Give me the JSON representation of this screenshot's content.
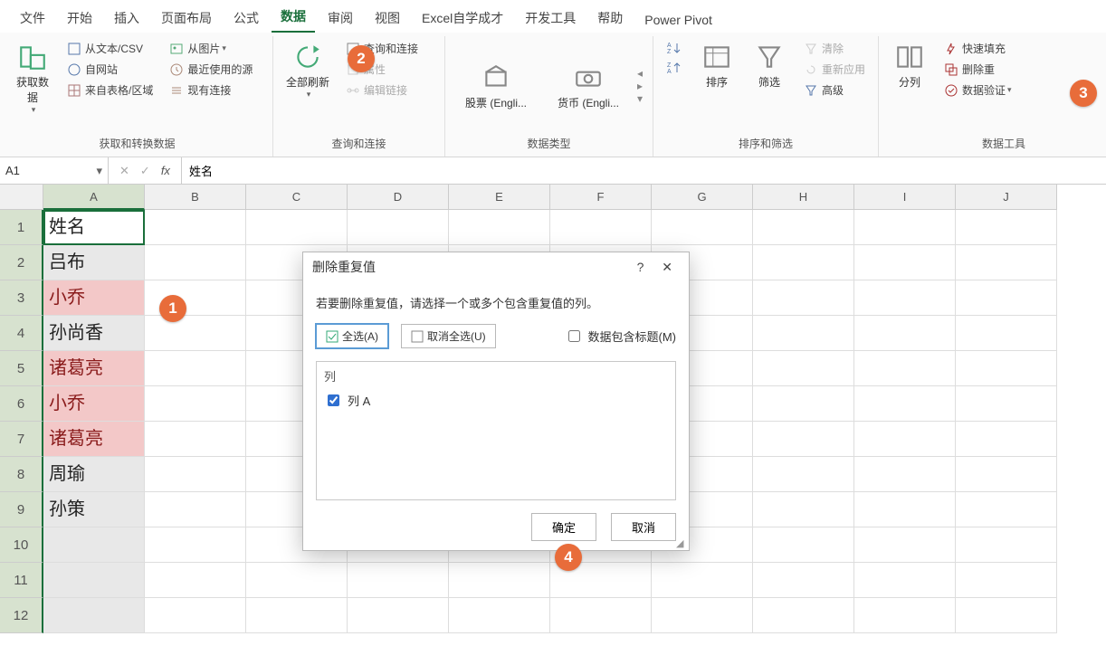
{
  "tabs": {
    "file": "文件",
    "home": "开始",
    "insert": "插入",
    "layout": "页面布局",
    "formulas": "公式",
    "data": "数据",
    "review": "审阅",
    "view": "视图",
    "self_learn": "Excel自学成才",
    "developer": "开发工具",
    "help": "帮助",
    "power_pivot": "Power Pivot",
    "active": "data"
  },
  "ribbon": {
    "group1": {
      "label": "获取和转换数据",
      "get_data": "获取数\n据",
      "from_text_csv": "从文本/CSV",
      "from_web": "自网站",
      "from_table": "来自表格/区域",
      "from_picture": "从图片",
      "recent": "最近使用的源",
      "existing_conn": "现有连接"
    },
    "group2": {
      "label": "查询和连接",
      "refresh_all": "全部刷新",
      "queries": "查询和连接",
      "properties": "属性",
      "edit_links": "编辑链接"
    },
    "group3": {
      "label": "数据类型",
      "stocks": "股票 (Engli...",
      "currency": "货币 (Engli..."
    },
    "group4": {
      "label": "排序和筛选",
      "sort": "排序",
      "filter": "筛选",
      "clear": "清除",
      "reapply": "重新应用",
      "advanced": "高级"
    },
    "group5": {
      "label": "数据工具",
      "text_to_cols": "分列",
      "flash_fill": "快速填充",
      "remove_dups": "删除重",
      "data_validation": "数据验证"
    }
  },
  "name_box": {
    "value": "A1"
  },
  "formula_bar": {
    "value": "姓名"
  },
  "columns": [
    "A",
    "B",
    "C",
    "D",
    "E",
    "F",
    "G",
    "H",
    "I",
    "J"
  ],
  "selected_column_index": 0,
  "rows": [
    {
      "num": "1",
      "a": "姓名",
      "dup": false,
      "active": true
    },
    {
      "num": "2",
      "a": "吕布",
      "dup": false
    },
    {
      "num": "3",
      "a": "小乔",
      "dup": true
    },
    {
      "num": "4",
      "a": "孙尚香",
      "dup": false
    },
    {
      "num": "5",
      "a": "诸葛亮",
      "dup": true
    },
    {
      "num": "6",
      "a": "小乔",
      "dup": true
    },
    {
      "num": "7",
      "a": "诸葛亮",
      "dup": true
    },
    {
      "num": "8",
      "a": "周瑜",
      "dup": false
    },
    {
      "num": "9",
      "a": "孙策",
      "dup": false
    },
    {
      "num": "10",
      "a": "",
      "dup": false
    },
    {
      "num": "11",
      "a": "",
      "dup": false
    },
    {
      "num": "12",
      "a": "",
      "dup": false
    }
  ],
  "dialog": {
    "title": "删除重复值",
    "message": "若要删除重复值，请选择一个或多个包含重复值的列。",
    "select_all": "全选(A)",
    "deselect_all": "取消全选(U)",
    "has_header_label": "数据包含标题(M)",
    "has_header_checked": false,
    "list_header": "列",
    "list_items": [
      {
        "label": "列 A",
        "checked": true
      }
    ],
    "ok": "确定",
    "cancel": "取消"
  },
  "callouts": {
    "c1": "1",
    "c2": "2",
    "c3": "3",
    "c4": "4"
  },
  "colors": {
    "accent": "#1a6f3b",
    "callout": "#e86c3a",
    "dup_bg": "#f3c8c8",
    "dup_fg": "#8a1b1b",
    "sel_bg": "#e8e8e8"
  }
}
